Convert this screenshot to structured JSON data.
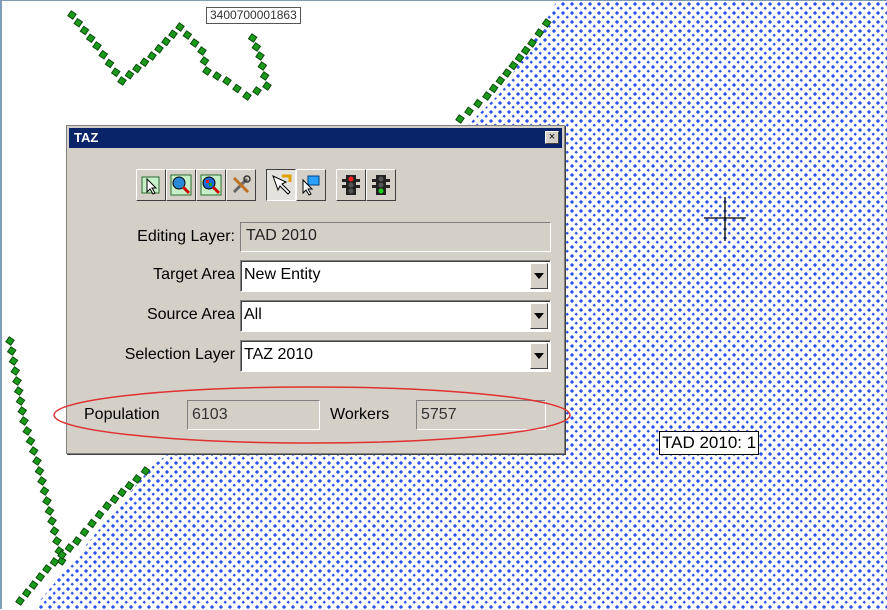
{
  "map": {
    "taz_id_label": "3400700001863",
    "tad_label": "TAD 2010: 1",
    "colors": {
      "hatch": "#2a52f0",
      "boundary_dots": "#1a9a1a",
      "highlight_ellipse": "#e03030"
    },
    "cursor_icon": "crosshair-icon"
  },
  "dialog": {
    "title": "TAZ",
    "close_label": "×",
    "toolbar": [
      {
        "name": "select-tool-button",
        "icon": "select-arrow-icon"
      },
      {
        "name": "zoom-selection-button",
        "icon": "magnifier-icon"
      },
      {
        "name": "zoom-layer-button",
        "icon": "magnifier-map-icon"
      },
      {
        "name": "settings-tool-button",
        "icon": "tools-icon"
      },
      {
        "name": "pointer-select-button",
        "icon": "pointer-select-icon"
      },
      {
        "name": "pointer-edit-button",
        "icon": "pointer-edit-icon"
      },
      {
        "name": "stop-signal-button",
        "icon": "traffic-light-red-icon"
      },
      {
        "name": "go-signal-button",
        "icon": "traffic-light-green-icon"
      }
    ],
    "editing_layer": {
      "label": "Editing Layer:",
      "value": "TAD 2010"
    },
    "target_area": {
      "label": "Target Area",
      "value": "New Entity"
    },
    "source_area": {
      "label": "Source Area",
      "value": "All"
    },
    "selection_layer": {
      "label": "Selection Layer",
      "value": "TAZ 2010"
    },
    "population": {
      "label": "Population",
      "value": "6103"
    },
    "workers": {
      "label": "Workers",
      "value": "5757"
    }
  }
}
